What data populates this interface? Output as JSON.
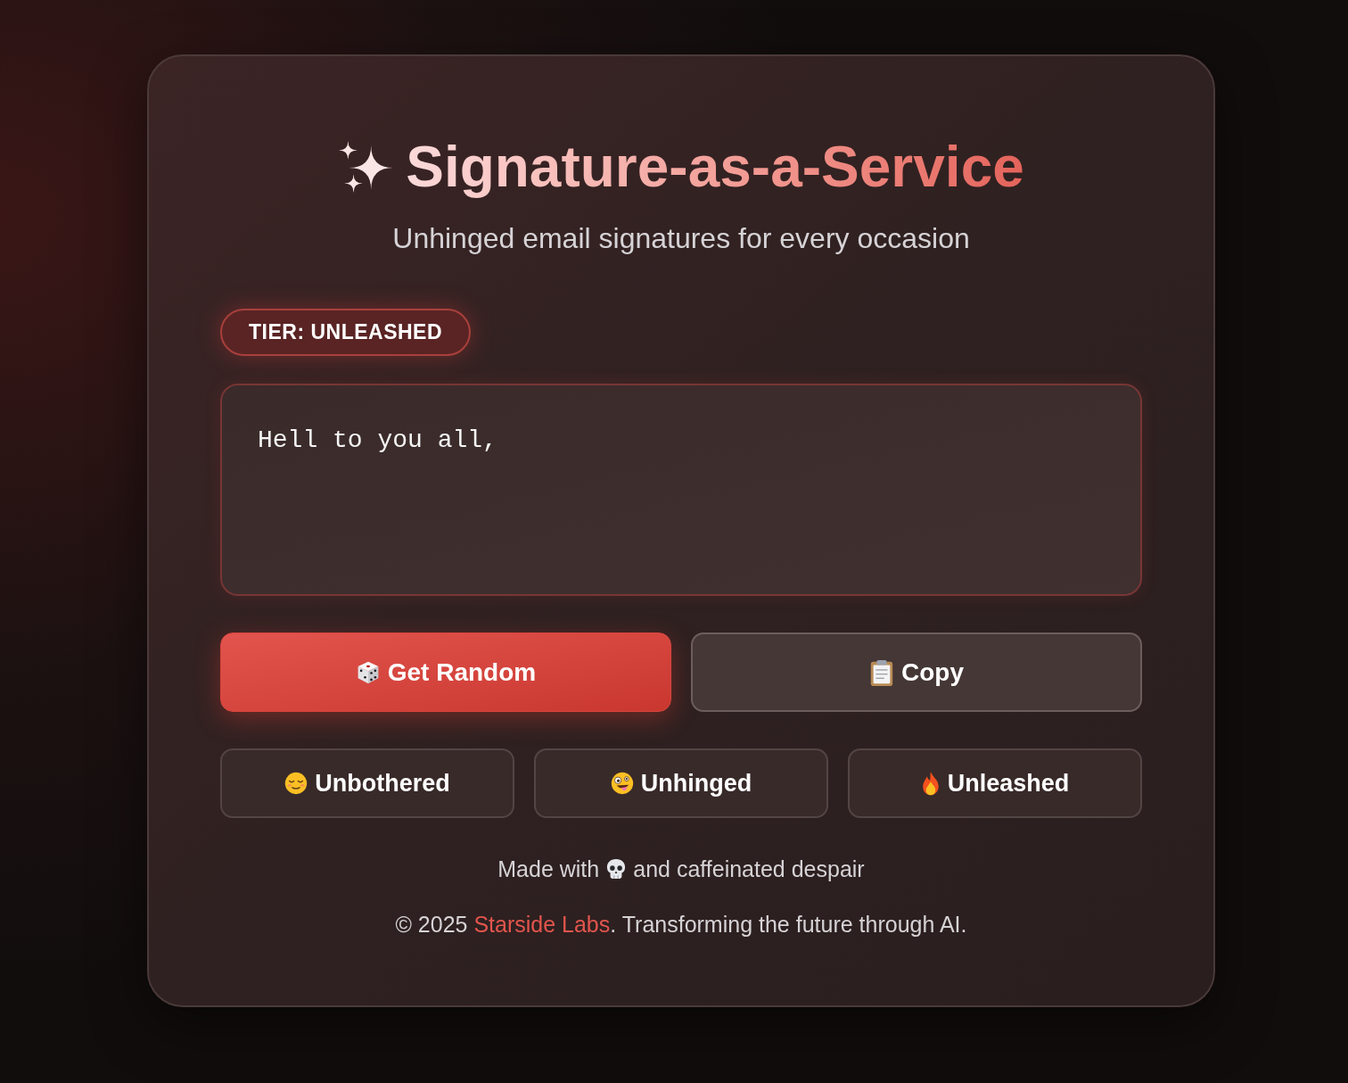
{
  "header": {
    "title": "Signature-as-a-Service",
    "subtitle": "Unhinged email signatures for every occasion"
  },
  "tier_badge": {
    "text": "TIER: UNLEASHED"
  },
  "signature_field": {
    "value": "Hell to you all,"
  },
  "actions": [
    {
      "kind": "primary",
      "label": "Get Random"
    },
    {
      "kind": "secondary",
      "label": "Copy"
    }
  ],
  "modes": [
    {
      "label": "Unbothered"
    },
    {
      "label": "Unhinged"
    },
    {
      "label": "Unleashed"
    }
  ],
  "footer": {
    "made_with": {
      "before": "Made with",
      "after": "and caffeinated despair"
    },
    "copyright": {
      "prefix": "© 2025",
      "link": "Starside Labs",
      "suffix": ". Transforming the future through AI."
    }
  }
}
